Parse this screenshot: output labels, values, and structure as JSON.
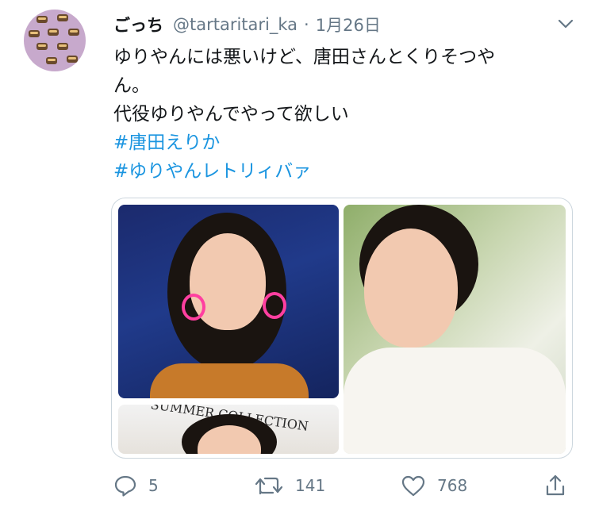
{
  "tweet": {
    "author_name": "ごっち",
    "handle": "@tartaritari_ka",
    "separator": "·",
    "date": "1月26日",
    "lines": [
      "ゆりやんには悪いけど、唐田さんとくりそつや",
      "ん。",
      "代役ゆりやんでやって欲しい"
    ],
    "hashtags": [
      "#唐田えりか",
      "#ゆりやんレトリィバァ"
    ],
    "media_caption_text": "SUMMER COLLECTION"
  },
  "actions": {
    "reply_count": "5",
    "retweet_count": "141",
    "like_count": "768"
  },
  "icons": {
    "reply": "reply-icon",
    "retweet": "retweet-icon",
    "like": "heart-icon",
    "share": "share-icon",
    "more": "chevron-down-icon"
  },
  "colors": {
    "link": "#1b95e0",
    "muted": "#657786",
    "avatar_bg": "#c7a9cc"
  }
}
